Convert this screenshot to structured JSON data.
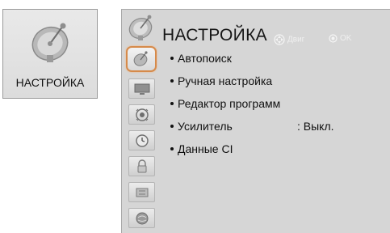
{
  "tile": {
    "icon": "satellite-dish-icon",
    "label": "НАСТРОЙКА"
  },
  "panel": {
    "header_icon": "satellite-dish-icon",
    "title": "НАСТРОЙКА",
    "hint_move": "Двиг",
    "hint_ok": "OK",
    "hint_move_icon": "navigation-arrows-icon",
    "hint_ok_icon": "ok-button-icon"
  },
  "sidebar": {
    "items": [
      {
        "icon": "satellite-dish-icon",
        "active": true
      },
      {
        "icon": "monitor-icon",
        "active": false
      },
      {
        "icon": "speaker-icon",
        "active": false
      },
      {
        "icon": "clock-icon",
        "active": false
      },
      {
        "icon": "lock-icon",
        "active": false
      },
      {
        "icon": "input-connector-icon",
        "active": false
      },
      {
        "icon": "globe-icon",
        "active": false
      }
    ]
  },
  "menu": {
    "items": [
      {
        "label": "Автопоиск"
      },
      {
        "label": "Ручная настройка"
      },
      {
        "label": "Редактор программ"
      },
      {
        "label": "Усилитель",
        "value": ": Выкл."
      },
      {
        "label": "Данные CI"
      }
    ]
  },
  "colors": {
    "panel_bg": "#d6d6d6",
    "active_border": "#d68a4a",
    "hint_text": "#f0f0f0"
  }
}
